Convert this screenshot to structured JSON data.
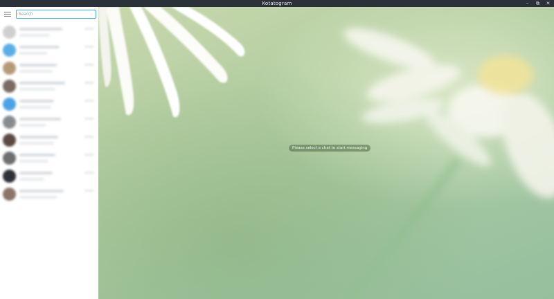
{
  "window": {
    "title": "Kotatogram",
    "controls": [
      {
        "name": "minimize",
        "glyph": "–"
      },
      {
        "name": "maximize",
        "glyph": "⧉"
      },
      {
        "name": "close",
        "glyph": "✕"
      }
    ]
  },
  "sidebar": {
    "menu_icon": "hamburger-menu-icon",
    "search": {
      "placeholder": "Search",
      "value": ""
    },
    "chats": [
      {
        "avatar_color": "#cfcfcf"
      },
      {
        "avatar_color": "#5aaee8"
      },
      {
        "avatar_color": "#b59a7a"
      },
      {
        "avatar_color": "#7b6a64"
      },
      {
        "avatar_color": "#4aa3e6"
      },
      {
        "avatar_color": "#888c90"
      },
      {
        "avatar_color": "#5b4a44"
      },
      {
        "avatar_color": "#6e6e70"
      },
      {
        "avatar_color": "#2d3138"
      },
      {
        "avatar_color": "#8a7566"
      }
    ]
  },
  "main": {
    "empty_message": "Please select a chat to start messaging"
  },
  "colors": {
    "titlebar": "#2b3138",
    "search_border": "#48a8e4",
    "pill": "#5a7650"
  }
}
